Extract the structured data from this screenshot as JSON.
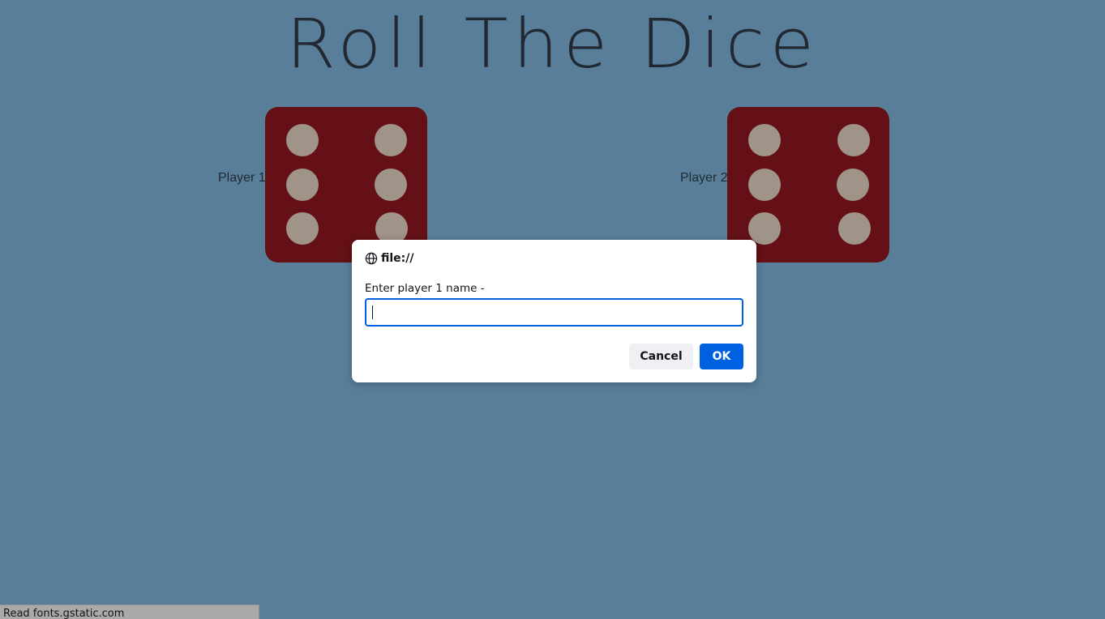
{
  "page": {
    "title": "Roll The Dice"
  },
  "players": [
    {
      "label": "Player 1",
      "die_value": 6
    },
    {
      "label": "Player 2",
      "die_value": 6
    }
  ],
  "dialog": {
    "origin": "file://",
    "origin_icon": "globe-icon",
    "message": "Enter player 1 name -",
    "input_value": "",
    "cancel_label": "Cancel",
    "ok_label": "OK"
  },
  "status_bar": {
    "text": "Read fonts.gstatic.com"
  },
  "colors": {
    "background": "#587e99",
    "die_face": "#641016",
    "die_pip": "#a09488",
    "accent": "#0061e0"
  }
}
